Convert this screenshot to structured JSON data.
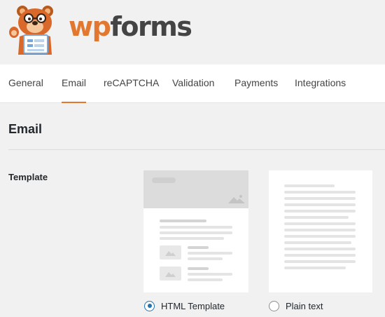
{
  "brand": {
    "prefix": "wp",
    "suffix": "forms",
    "logo_icon": "bear-mascot-icon"
  },
  "tabs": [
    {
      "label": "General",
      "active": false
    },
    {
      "label": "Email",
      "active": true
    },
    {
      "label": "reCAPTCHA",
      "active": false
    },
    {
      "label": "Validation",
      "active": false
    },
    {
      "label": "Payments",
      "active": false
    },
    {
      "label": "Integrations",
      "active": false
    }
  ],
  "section": {
    "title": "Email"
  },
  "template": {
    "label": "Template",
    "options": [
      {
        "label": "HTML Template",
        "selected": true
      },
      {
        "label": "Plain text",
        "selected": false
      }
    ]
  },
  "colors": {
    "accent": "#e27730",
    "radio": "#2271b1",
    "brand_text": "#444444"
  }
}
